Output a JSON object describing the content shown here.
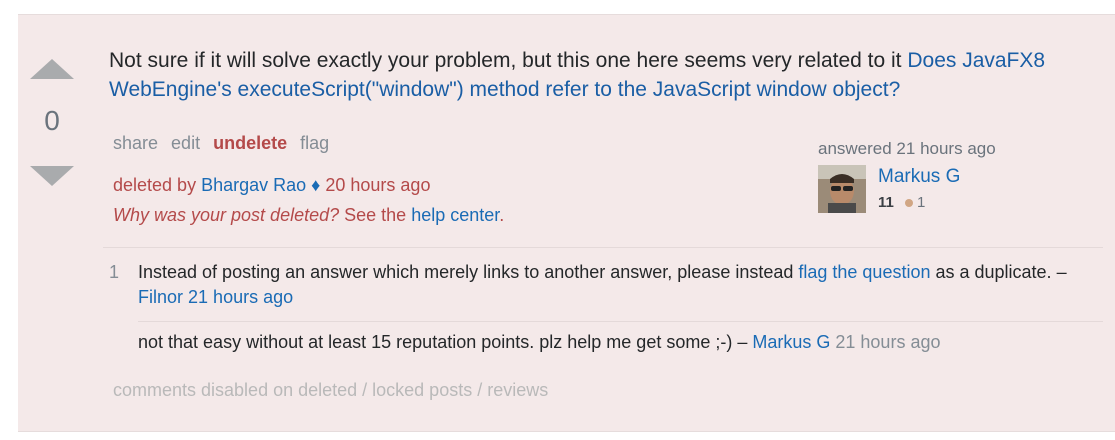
{
  "vote": {
    "count": "0"
  },
  "post": {
    "text": "Not sure if it will solve exactly your problem, but this one here seems very related to it ",
    "link_text": "Does JavaFX8 WebEngine's executeScript(\"window\") method refer to the JavaScript window object?"
  },
  "menu": {
    "share": "share",
    "edit": "edit",
    "undelete": "undelete",
    "flag": "flag"
  },
  "deleted": {
    "prefix": "deleted by ",
    "by": "Bhargav Rao",
    "diamond": "♦",
    "when": "20 hours ago",
    "why": "Why was your post deleted?",
    "see": "See the",
    "help_center": "help center",
    "dot": "."
  },
  "user_card": {
    "answered": "answered 21 hours ago",
    "name": "Markus G",
    "rep": "11",
    "bronze": "1"
  },
  "comments": [
    {
      "score": "1",
      "text_before": "Instead of posting an answer which merely links to another answer, please instead ",
      "link": "flag the question",
      "text_after": " as a duplicate. – ",
      "user": "Filnor",
      "time": "21 hours ago"
    },
    {
      "score": "",
      "text_before": "not that easy without at least 15 reputation points. plz help me get some ;-) – ",
      "user": "Markus G",
      "time": "21 hours ago"
    }
  ],
  "comments_disabled": "comments disabled on deleted / locked posts / reviews"
}
